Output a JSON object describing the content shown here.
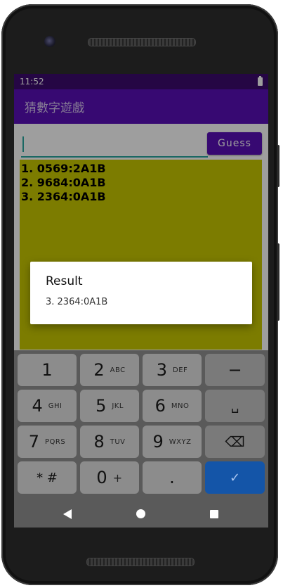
{
  "status_bar": {
    "time": "11:52"
  },
  "app_bar": {
    "title": "猜數字遊戲"
  },
  "input": {
    "value": "",
    "placeholder": ""
  },
  "guess_button": {
    "label": "Guess"
  },
  "history": [
    "1. 0569:2A1B",
    "2. 9684:0A1B",
    "3. 2364:0A1B"
  ],
  "dialog": {
    "title": "Result",
    "message": "3. 2364:0A1B"
  },
  "keyboard": {
    "keys": [
      {
        "digit": "1",
        "letters": ""
      },
      {
        "digit": "2",
        "letters": "ABC"
      },
      {
        "digit": "3",
        "letters": "DEF"
      },
      {
        "digit": "−",
        "letters": ""
      },
      {
        "digit": "4",
        "letters": "GHI"
      },
      {
        "digit": "5",
        "letters": "JKL"
      },
      {
        "digit": "6",
        "letters": "MNO"
      },
      {
        "digit": "␣",
        "letters": ""
      },
      {
        "digit": "7",
        "letters": "PQRS"
      },
      {
        "digit": "8",
        "letters": "TUV"
      },
      {
        "digit": "9",
        "letters": "WXYZ"
      },
      {
        "digit": "⌫",
        "letters": ""
      },
      {
        "digit": "* #",
        "letters": ""
      },
      {
        "digit": "0",
        "letters": "+"
      },
      {
        "digit": ".",
        "letters": ""
      },
      {
        "digit": "✓",
        "letters": ""
      }
    ]
  },
  "colors": {
    "status_bar": "#3d0a6e",
    "app_bar": "#5a0fb8",
    "history_bg": "#c8c800",
    "input_underline": "#2aa8a0",
    "enter_key": "#1455a8"
  }
}
